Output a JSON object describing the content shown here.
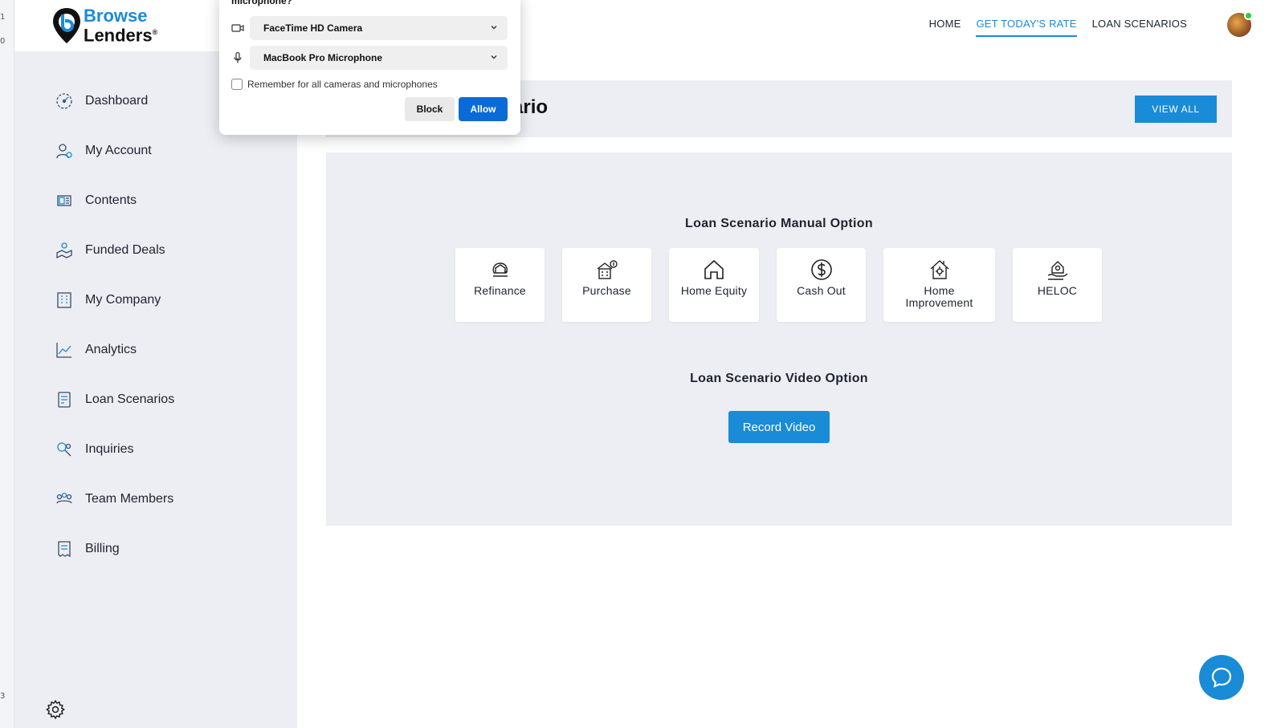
{
  "colors": {
    "accent": "#1a8bd6",
    "sidebar_bg": "#eceef3",
    "allow_button": "#0b6bd6",
    "status_online": "#2ecc40"
  },
  "logo": {
    "line1": "Browse",
    "line2": "Lenders",
    "mark": "®"
  },
  "topnav": [
    {
      "label": "HOME",
      "active": false
    },
    {
      "label": "GET TODAY'S RATE",
      "active": true
    },
    {
      "label": "LOAN SCENARIOS",
      "active": false
    }
  ],
  "sidebar": {
    "items": [
      {
        "label": "Dashboard",
        "icon": "dashboard-icon"
      },
      {
        "label": "My Account",
        "icon": "account-icon"
      },
      {
        "label": "Contents",
        "icon": "contents-icon"
      },
      {
        "label": "Funded Deals",
        "icon": "funded-deals-icon"
      },
      {
        "label": "My Company",
        "icon": "company-icon"
      },
      {
        "label": "Analytics",
        "icon": "analytics-icon"
      },
      {
        "label": "Loan Scenarios",
        "icon": "loan-scenarios-icon"
      },
      {
        "label": "Inquiries",
        "icon": "inquiries-icon"
      },
      {
        "label": "Team Members",
        "icon": "team-members-icon"
      },
      {
        "label": "Billing",
        "icon": "billing-icon"
      }
    ],
    "settings_icon": "gear-icon"
  },
  "banner": {
    "title_visible": "ario",
    "view_all": "VIEW ALL"
  },
  "manual": {
    "title": "Loan Scenario Manual Option",
    "options": [
      {
        "label": "Refinance",
        "icon": "refinance-icon"
      },
      {
        "label": "Purchase",
        "icon": "purchase-icon"
      },
      {
        "label": "Home Equity",
        "icon": "home-equity-icon"
      },
      {
        "label": "Cash Out",
        "icon": "cash-out-icon"
      },
      {
        "label": "Home Improvement",
        "icon": "home-improvement-icon"
      },
      {
        "label": "HELOC",
        "icon": "heloc-icon"
      }
    ]
  },
  "video": {
    "title": "Loan Scenario Video Option",
    "button": "Record Video"
  },
  "permission_popup": {
    "title": "microphone?",
    "camera": "FaceTime HD Camera",
    "microphone": "MacBook Pro Microphone",
    "remember": "Remember for all cameras and microphones",
    "remember_checked": false,
    "block": "Block",
    "allow": "Allow"
  },
  "chat_icon": "chat-bubble-icon",
  "edge_glyphs": [
    "1",
    "0",
    "3"
  ]
}
